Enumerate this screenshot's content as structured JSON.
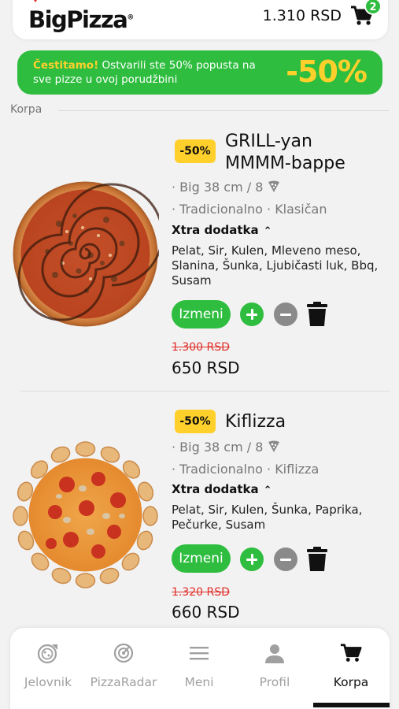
{
  "header": {
    "logo_text": "BigPizza",
    "cart_total": "1.310 RSD",
    "cart_count": "2"
  },
  "promo": {
    "highlight": "Čestitamo!",
    "text": " Ostvarili ste 50% popusta na sve pizze u ovoj porudžbini",
    "discount": "-50%"
  },
  "section": {
    "label": "Korpa"
  },
  "items": [
    {
      "badge": "-50%",
      "name_line1": "GRILL-yan",
      "name_line2": "MMMM-bappe",
      "size": "· Big 38 cm / 8",
      "style": "· Tradicionalno · Klasičan",
      "xtra_label": "Xtra dodatka",
      "toppings_line1": "Pelat, Sir, Kulen, Mleveno meso,",
      "toppings_line2": "Slanina, Šunka, Ljubičasti luk, Bbq,",
      "toppings_line3": "Susam",
      "edit_label": "Izmeni",
      "old_price": "1.300 RSD",
      "new_price": "650 RSD"
    },
    {
      "badge": "-50%",
      "name_line1": "Kiflizza",
      "size": "· Big 38 cm / 8",
      "style": "· Tradicionalno · Kiflizza",
      "xtra_label": "Xtra dodatka",
      "toppings_line1": "Pelat, Sir, Kulen, Šunka, Paprika,",
      "toppings_line2": "Pečurke, Susam",
      "edit_label": "Izmeni",
      "old_price": "1.320 RSD",
      "new_price": "660 RSD"
    }
  ],
  "nav": [
    {
      "label": "Jelovnik",
      "icon": "pizza-menu-icon"
    },
    {
      "label": "PizzaRadar",
      "icon": "radar-icon"
    },
    {
      "label": "Meni",
      "icon": "hamburger-icon"
    },
    {
      "label": "Profil",
      "icon": "user-icon"
    },
    {
      "label": "Korpa",
      "icon": "cart-icon",
      "active": true
    }
  ],
  "colors": {
    "accent_green": "#2ebd3f",
    "promo_yellow": "#ffd02b",
    "price_red": "#e0302a"
  }
}
